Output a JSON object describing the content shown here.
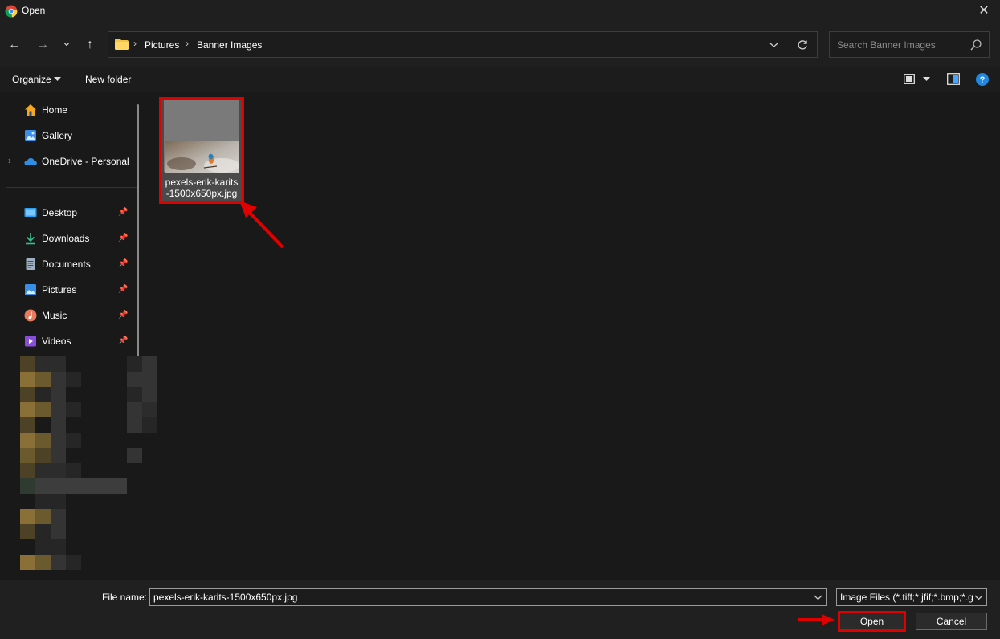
{
  "window": {
    "title": "Open",
    "close_symbol": "✕"
  },
  "nav": {
    "back": "←",
    "forward": "→",
    "recent": "⌄",
    "up": "↑",
    "breadcrumb": [
      "Pictures",
      "Banner Images"
    ],
    "separator": "›",
    "search_placeholder": "Search Banner Images"
  },
  "toolbar": {
    "organize": "Organize",
    "new_folder": "New folder"
  },
  "sidebar": {
    "quick": [
      {
        "label": "Home",
        "icon": "home-icon"
      },
      {
        "label": "Gallery",
        "icon": "gallery-icon"
      },
      {
        "label": "OneDrive - Personal",
        "icon": "onedrive-icon"
      }
    ],
    "pinned": [
      {
        "label": "Desktop",
        "icon": "desktop-icon"
      },
      {
        "label": "Downloads",
        "icon": "downloads-icon"
      },
      {
        "label": "Documents",
        "icon": "documents-icon"
      },
      {
        "label": "Pictures",
        "icon": "pictures-icon"
      },
      {
        "label": "Music",
        "icon": "music-icon"
      },
      {
        "label": "Videos",
        "icon": "videos-icon"
      }
    ]
  },
  "files": [
    {
      "name_line1": "pexels-erik-karits",
      "name_line2": "-1500x650px.jpg",
      "selected": true
    }
  ],
  "footer": {
    "file_name_label": "File name:",
    "file_name_value": "pexels-erik-karits-1500x650px.jpg",
    "filter_value": "Image Files (*.tiff;*.jfif;*.bmp;*.gif",
    "open_label": "Open",
    "cancel_label": "Cancel"
  },
  "colors": {
    "highlight": "#e00000",
    "background": "#191919",
    "accent_blue": "#1e88e5"
  }
}
